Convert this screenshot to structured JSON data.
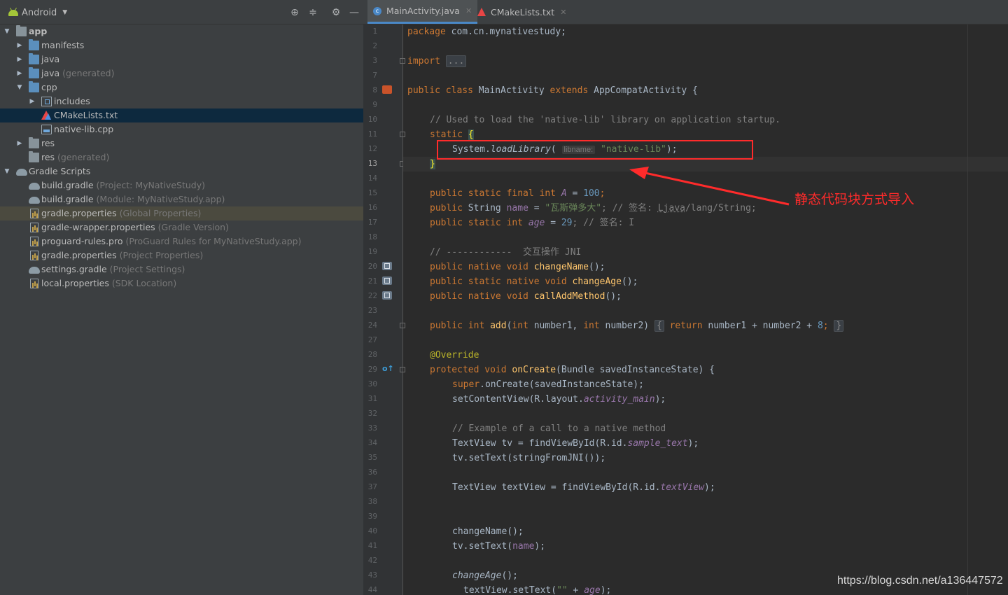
{
  "project_panel": {
    "view_selector": "Android",
    "tree": [
      {
        "label": "app",
        "extra": ""
      },
      {
        "label": "manifests",
        "extra": ""
      },
      {
        "label": "java",
        "extra": ""
      },
      {
        "label": "java",
        "extra": " (generated)"
      },
      {
        "label": "cpp",
        "extra": ""
      },
      {
        "label": "includes",
        "extra": ""
      },
      {
        "label": "CMakeLists.txt",
        "extra": ""
      },
      {
        "label": "native-lib.cpp",
        "extra": ""
      },
      {
        "label": "res",
        "extra": ""
      },
      {
        "label": "res",
        "extra": " (generated)"
      },
      {
        "label": "Gradle Scripts",
        "extra": ""
      },
      {
        "label": "build.gradle",
        "extra": " (Project: MyNativeStudy)"
      },
      {
        "label": "build.gradle",
        "extra": " (Module: MyNativeStudy.app)"
      },
      {
        "label": "gradle.properties",
        "extra": " (Global Properties)"
      },
      {
        "label": "gradle-wrapper.properties",
        "extra": " (Gradle Version)"
      },
      {
        "label": "proguard-rules.pro",
        "extra": " (ProGuard Rules for MyNativeStudy.app)"
      },
      {
        "label": "gradle.properties",
        "extra": " (Project Properties)"
      },
      {
        "label": "settings.gradle",
        "extra": " (Project Settings)"
      },
      {
        "label": "local.properties",
        "extra": " (SDK Location)"
      }
    ]
  },
  "tabs": [
    {
      "label": "MainActivity.java",
      "icon": "class-icon",
      "active": true
    },
    {
      "label": "CMakeLists.txt",
      "icon": "cmake-icon",
      "active": false
    }
  ],
  "editor": {
    "line_numbers": [
      "1",
      "2",
      "3",
      "7",
      "8",
      "9",
      "10",
      "11",
      "12",
      "13",
      "14",
      "15",
      "16",
      "17",
      "18",
      "19",
      "20",
      "21",
      "22",
      "23",
      "24",
      "27",
      "28",
      "29",
      "30",
      "31",
      "32",
      "33",
      "34",
      "35",
      "36",
      "37",
      "38",
      "39",
      "40",
      "41",
      "42",
      "43",
      "44"
    ],
    "current_line": "13",
    "lines": {
      "l1": {
        "a": "package",
        "b": " com.cn.mynativestudy;"
      },
      "l3": {
        "a": "import",
        "b": "..."
      },
      "l8": {
        "a": "public class",
        "b": " MainActivity ",
        "c": "extends",
        "d": " AppCompatActivity {"
      },
      "l10": "// Used to load the 'native-lib' library on application startup.",
      "l11": {
        "a": "static",
        "b": "{"
      },
      "l12": {
        "a": "System.",
        "b": "loadLibrary",
        "c": "(",
        "hint": "libname:",
        "d": "\"native-lib\"",
        "e": ");"
      },
      "l13": "}",
      "l15": {
        "a": "public static final int",
        "b": "A",
        "c": " = ",
        "d": "100",
        "e": ";"
      },
      "l16": {
        "a": "public",
        "b": " String ",
        "c": "name",
        "d": " = ",
        "e": "\"瓦斯弹多大\"",
        "f": "; // 签名: ",
        "g": "Ljava",
        "h": "/lang/String;"
      },
      "l17": {
        "a": "public static int",
        "b": "age",
        "c": " = ",
        "d": "29",
        "e": "; // 签名: I"
      },
      "l19": "// ------------  交互操作 JNI",
      "l20": {
        "a": "public native void",
        "b": "changeName",
        "c": "();"
      },
      "l21": {
        "a": "public static native void",
        "b": "changeAge",
        "c": "();"
      },
      "l22": {
        "a": "public native void",
        "b": "callAddMethod",
        "c": "();"
      },
      "l24": {
        "a": "public int",
        "b": "add",
        "c": "(",
        "d": "int",
        "e": " number1, ",
        "f": "int",
        "g": " number2)",
        "h": "{",
        "i": "return",
        "j": " number1 + number2 + ",
        "k": "8",
        "l": ";",
        "m": "}"
      },
      "l28": "@Override",
      "l29": {
        "a": "protected void",
        "b": "onCreate",
        "c": "(Bundle savedInstanceState) {"
      },
      "l30": {
        "a": "super",
        "b": ".onCreate(savedInstanceState);"
      },
      "l31": {
        "a": "setContentView(R.layout.",
        "b": "activity_main",
        "c": ");"
      },
      "l33": "// Example of a call to a native method",
      "l34": {
        "a": "TextView tv = findViewById(R.id.",
        "b": "sample_text",
        "c": ");"
      },
      "l35": "tv.setText(stringFromJNI());",
      "l37": {
        "a": "TextView textView = findViewById(R.id.",
        "b": "textView",
        "c": ");"
      },
      "l40": "changeName();",
      "l41": {
        "a": "tv.setText(",
        "b": "name",
        "c": ");"
      },
      "l43": {
        "a": "changeAge",
        "b": "();"
      },
      "l44": {
        "a": "textView.setText(",
        "b": "\"\"",
        "c": " + ",
        "d": "age",
        "e": ");"
      }
    }
  },
  "annotation": {
    "text": "静态代码块方式导入",
    "color": "#ff2b2b"
  },
  "watermark": "https://blog.csdn.net/a136447572",
  "colors": {
    "panel_bg": "#3c3f41",
    "editor_bg": "#2b2b2b",
    "keyword": "#cc7832",
    "string": "#6a8759",
    "number": "#6897bb",
    "function": "#ffc66d",
    "field": "#9876aa",
    "comment": "#808080",
    "selection": "#0d293e"
  }
}
